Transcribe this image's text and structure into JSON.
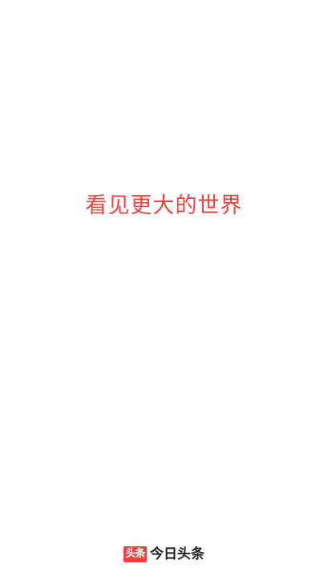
{
  "splash": {
    "slogan": "看见更大的世界",
    "slogan_color": "#f04142",
    "background_color": "#ffffff"
  },
  "brand": {
    "logo_text": "头条",
    "logo_color": "#f04142",
    "name": "今日头条"
  }
}
